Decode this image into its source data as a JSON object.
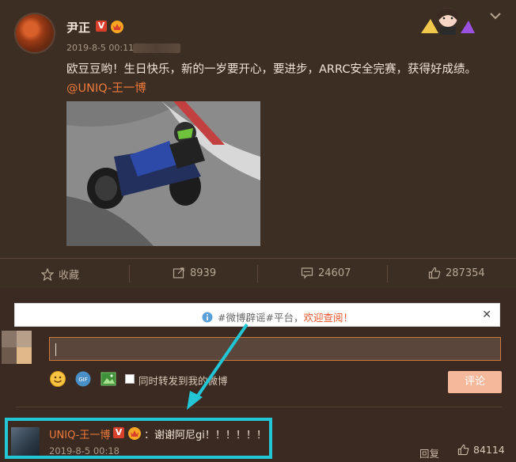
{
  "post": {
    "author": "尹正",
    "verified_badge": "V",
    "time": "2019-8-5 00:11",
    "text_main": "欧豆豆哟！生日快乐，新的一岁要开心，要进步，ARRC安全完赛，获得好成绩。",
    "mention": "@UNIQ-王一博"
  },
  "actions": {
    "collect": "收藏",
    "repost_count": "8939",
    "comment_count": "24607",
    "like_count": "287354"
  },
  "notice": {
    "prefix": "#微博辟谣#平台，",
    "highlight": "欢迎查阅！"
  },
  "composer": {
    "repost_option": "同时转发到我的微博",
    "submit": "评论"
  },
  "comment": {
    "name": "UNIQ-王一博",
    "verified_badge": "V",
    "text": "：谢谢阿尼gi！！！！！！",
    "time": "2019-8-5 00:18",
    "reply": "回复",
    "likes": "84114"
  },
  "colors": {
    "accent": "#ee7a3b",
    "highlight_box": "#22c6d6",
    "background": "#3b2c23"
  }
}
